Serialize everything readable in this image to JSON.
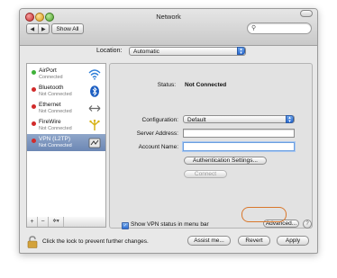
{
  "window": {
    "title": "Network"
  },
  "toolbar": {
    "back": "◀",
    "forward": "▶",
    "show_all": "Show All",
    "search_placeholder": "",
    "search_icon": "search-icon"
  },
  "location": {
    "label": "Location:",
    "value": "Automatic"
  },
  "services": [
    {
      "name": "AirPort",
      "status": "Connected",
      "status_color": "#3fb23a",
      "icon": "wifi-icon"
    },
    {
      "name": "Bluetooth",
      "status": "Not Connected",
      "status_color": "#d12b2b",
      "icon": "bluetooth-icon"
    },
    {
      "name": "Ethernet",
      "status": "Not Connected",
      "status_color": "#d12b2b",
      "icon": "ethernet-icon"
    },
    {
      "name": "FireWire",
      "status": "Not Connected",
      "status_color": "#d12b2b",
      "icon": "firewire-icon"
    },
    {
      "name": "VPN (L2TP)",
      "status": "Not Connected",
      "status_color": "#d12b2b",
      "icon": "vpn-icon",
      "selected": true
    }
  ],
  "list_controls": {
    "add": "+",
    "remove": "−",
    "action": "✲▾"
  },
  "detail": {
    "status_label": "Status:",
    "status_value": "Not Connected",
    "configuration_label": "Configuration:",
    "configuration_value": "Default",
    "server_label": "Server Address:",
    "server_value": "",
    "account_label": "Account Name:",
    "account_value": "",
    "auth_button": "Authentication Settings...",
    "connect_button": "Connect",
    "show_vpn_label": "Show VPN status in menu bar",
    "show_vpn_checked": true,
    "advanced_button": "Advanced...",
    "help": "?"
  },
  "footer": {
    "lock_text": "Click the lock to prevent further changes.",
    "assist_button": "Assist me...",
    "revert_button": "Revert",
    "apply_button": "Apply"
  },
  "colors": {
    "selection": "#7990bd",
    "highlight_ring": "#d9772b",
    "accent": "#2a6bd1"
  }
}
